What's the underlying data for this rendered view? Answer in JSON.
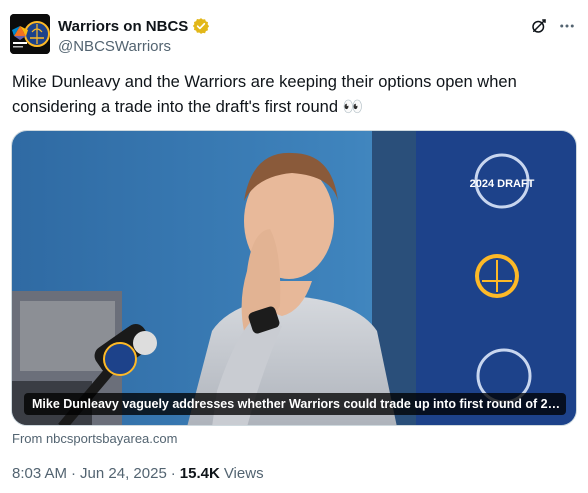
{
  "author": {
    "display_name": "Warriors on NBCS",
    "handle": "@NBCSWarriors",
    "verified_color": "#e2b719",
    "avatar_icon": "warriors-nbc-logo-icon"
  },
  "header_actions": {
    "grok_icon": "grok-icon",
    "more_icon": "more-icon"
  },
  "tweet": {
    "text": "Mike Dunleavy and the Warriors are keeping their options open when considering a trade into the draft's first round 👀"
  },
  "card": {
    "caption": "Mike Dunleavy vaguely addresses whether Warriors could trade up into first round of 2…",
    "source": "From nbcsportsbayarea.com",
    "image_subject": "press-conference-photo",
    "backdrop_text_primary": "2024 DRAFT"
  },
  "meta": {
    "time": "8:03 AM",
    "date": "Jun 24, 2025",
    "separator": "·",
    "views_count": "15.4K",
    "views_label": "Views"
  },
  "colors": {
    "text_primary": "#0f1419",
    "text_secondary": "#536471",
    "warriors_blue": "#1d428a",
    "warriors_gold": "#fdb927"
  }
}
